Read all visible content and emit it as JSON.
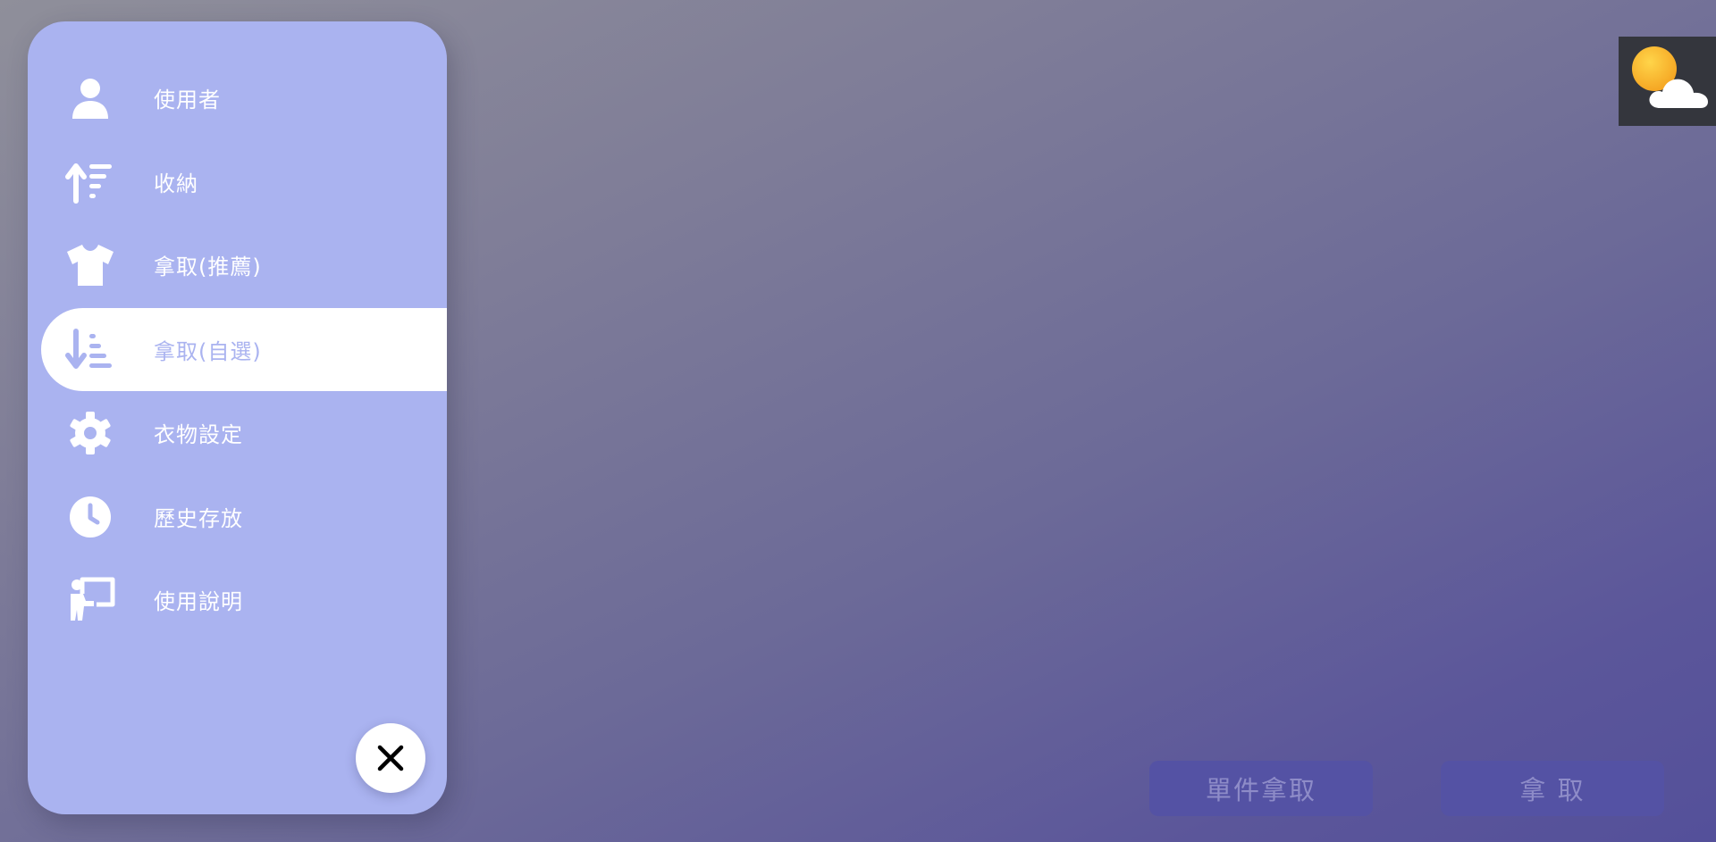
{
  "sidebar": {
    "items": [
      {
        "label": "使用者",
        "icon": "user-icon",
        "active": false
      },
      {
        "label": "收納",
        "icon": "sort-up-icon",
        "active": false
      },
      {
        "label": "拿取(推薦)",
        "icon": "tshirt-icon",
        "active": false
      },
      {
        "label": "拿取(自選)",
        "icon": "sort-down-icon",
        "active": true
      },
      {
        "label": "衣物設定",
        "icon": "gear-icon",
        "active": false
      },
      {
        "label": "歷史存放",
        "icon": "clock-icon",
        "active": false
      },
      {
        "label": "使用說明",
        "icon": "presentation-icon",
        "active": false
      }
    ],
    "close_icon": "close-icon"
  },
  "weather": {
    "icon": "partly-cloudy-icon"
  },
  "actions": {
    "single_take_label": "單件拿取",
    "take_label": "拿 取"
  },
  "colors": {
    "sidebar_bg": "#aab3f0",
    "active_item_bg": "#ffffff",
    "button_bg": "#5452a4",
    "button_text": "#8e8cc8",
    "weather_bg": "#34363d"
  }
}
